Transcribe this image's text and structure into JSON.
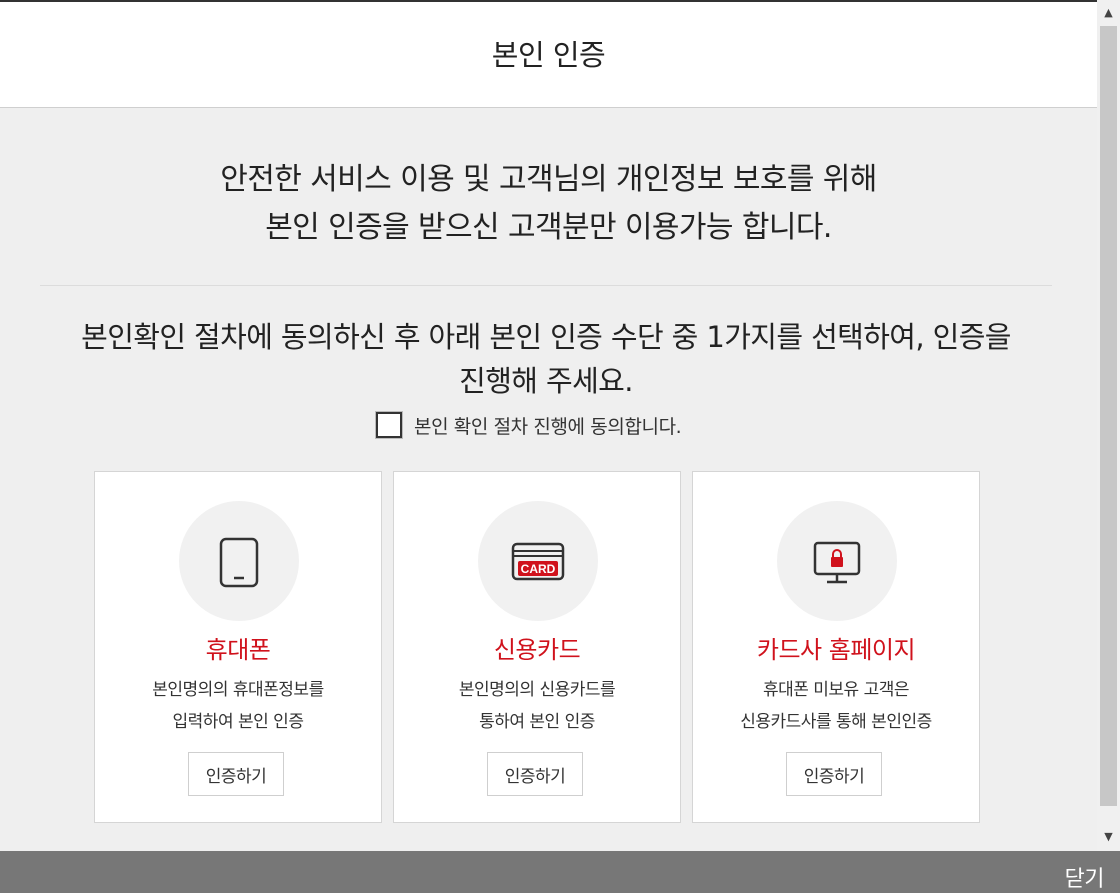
{
  "header": {
    "title": "본인 인증"
  },
  "intro": {
    "line1": "안전한 서비스 이용 및 고객님의 개인정보 보호를 위해",
    "line2": "본인 인증을 받으신 고객분만 이용가능 합니다."
  },
  "instruction": {
    "line1": "본인확인 절차에 동의하신 후 아래 본인 인증 수단 중 1가지를 선택하여, 인증을",
    "line2": "진행해 주세요."
  },
  "agreement": {
    "label": "본인 확인 절차 진행에 동의합니다.",
    "checked": false
  },
  "methods": [
    {
      "title": "휴대폰",
      "desc_line1": "본인명의의 휴대폰정보를",
      "desc_line2": "입력하여 본인 인증",
      "button": "인증하기",
      "icon": "mobile-phone-icon"
    },
    {
      "title": "신용카드",
      "desc_line1": "본인명의의 신용카드를",
      "desc_line2": "통하여 본인 인증",
      "button": "인증하기",
      "icon": "credit-card-icon",
      "icon_text": "CARD"
    },
    {
      "title": "카드사 홈페이지",
      "desc_line1": "휴대폰 미보유 고객은",
      "desc_line2": "신용카드사를 통해 본인인증",
      "button": "인증하기",
      "icon": "monitor-lock-icon"
    }
  ],
  "footer": {
    "close_label": "닫기"
  },
  "colors": {
    "accent": "#d0121c",
    "background": "#efefef",
    "footer": "#777777"
  }
}
